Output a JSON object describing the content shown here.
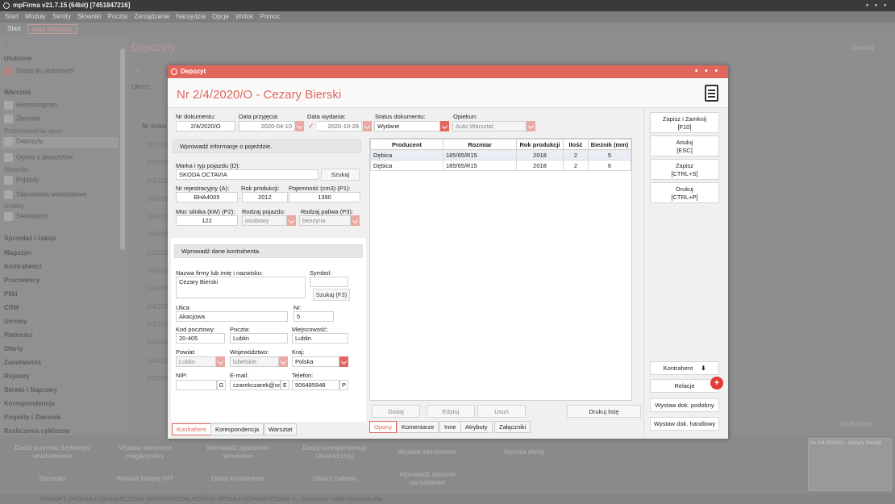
{
  "app": {
    "title": "mpFirma v21.7.15 (64bit) [7451847216]",
    "title_dots": "• • •"
  },
  "menu": [
    "Start",
    "Moduły",
    "Skróty",
    "Słowniki",
    "Poczta",
    "Zarządzanie",
    "Narzędzia",
    "Opcje",
    "Widok",
    "Pomoc"
  ],
  "tabs": [
    "Start",
    "Auto Warsztat"
  ],
  "sidebar": {
    "search_icon": "search-icon",
    "favorites": "Ulubione",
    "add_fav": "Dodaj do ulubionych",
    "workshop": "Warsztat",
    "items": [
      "Harmonogram",
      "Zlecenia"
    ],
    "tyre_storage": "Przechowalnia opon",
    "tyre_items": [
      "Depozyty",
      "Opony z depozytów"
    ],
    "dicts": "Słowniki",
    "dict_items": [
      "Pojazdy",
      "Stanowiska warsztatowe"
    ],
    "analytics": "Analizy",
    "analytics_items": [
      "Serwisanci"
    ],
    "sections": [
      "Sprzedaż i zakup",
      "Magazyn",
      "Kontrahenci",
      "Pracownicy",
      "Pliki",
      "CRM",
      "Umowy",
      "Płatności",
      "Oferty",
      "Zamówienia",
      "Rejestry",
      "Serwis i Naprawy",
      "Korespondencja",
      "Projekty i Zlecenia",
      "Rozliczenia cykliczne",
      "Raporty zbiorcze"
    ]
  },
  "background": {
    "page_title": "Depozyty",
    "close": "Zamknij",
    "period": "Okres:",
    "col": "Nr doku",
    "dates": [
      "2/7/202",
      "1/7/202",
      "4/4/202",
      "3/4/202",
      "2/4/202",
      "1/4/202",
      "1/11/20",
      "1/10/20",
      "1/5/202",
      "4/4/202",
      "3/4/202",
      "2/4/202",
      "1/4/202",
      "1/3/202"
    ],
    "print_list": "Drukuj listę",
    "right_title": "Nr 2/4/2020/O - Cezary Bierski"
  },
  "bottom_buttons": [
    [
      "Dodaj przyciski Szybkiego uruchamiania",
      "Wystaw dokument magazynowy",
      "Wprowadź zgłoszenie serwisowe",
      "Dodaj korespondencję (zewnętrzną)",
      "Wystaw zamówienie",
      "Wystaw ofertę"
    ],
    [
      "Sprzedaż",
      "Wystaw fakturę VAT",
      "Dodaj kontrahenta",
      "Utwórz zadanie",
      "Wprowadź zlecenie warsztatowe"
    ]
  ],
  "status_text": "BINSOFT SPÓŁKA Z OGRANICZONĄ ODPOWIEDZIALNOŚCIĄ SPÓŁKA KOMANDYTOWA n... Database: sqlite:Warsztat.dbx",
  "dialog": {
    "title": "Depozyt",
    "dots": "• • •",
    "heading": "Nr 2/4/2020/O - Cezary Bierski",
    "doc_no_label": "Nr dokumentu:",
    "doc_no": "2/4/2020/O",
    "date_in_label": "Data przyjęcia:",
    "date_in": "2020-04-10",
    "date_out_label": "Data wydania:",
    "date_out": "2020-10-28",
    "status_label": "Status dokumentu:",
    "status": "Wydane",
    "keeper_label": "Opiekun:",
    "keeper": "Auto Warsztat",
    "vehicle_section": "Wprowadź informacje o pojeździe.",
    "make_label": "Marka i typ pojazdu (D):",
    "make": "SKODA OCTAVIA",
    "search": "Szukaj",
    "reg_label": "Nr rejestracyjny (A):",
    "reg": "BHA4005",
    "year_label": "Rok produkcji:",
    "year": "2012",
    "capacity_label": "Pojemność (cm3) (P1):",
    "capacity": "1390",
    "power_label": "Moc silnika (kW) (P2):",
    "power": "122",
    "vtype_label": "Rodzaj pojazdu:",
    "vtype": "osobowy",
    "fuel_label": "Rodzaj paliwa (P3):",
    "fuel": "benzyna",
    "contractor_section": "Wprowadź dane kontrahenta.",
    "name_label": "Nazwa firmy lub imię i nazwisko:",
    "name": "Cezary Bierski",
    "symbol_label": "Symbol:",
    "symbol": "",
    "search_f3": "Szukaj (F3)",
    "street_label": "Ulica:",
    "street": "Akacjowa",
    "no_label": "Nr:",
    "no": "5",
    "zip_label": "Kod pocztowy:",
    "zip": "20-405",
    "post_label": "Poczta:",
    "post": "Lublin",
    "city_label": "Miejscowość:",
    "city": "Lublin",
    "county_label": "Powiat:",
    "county": "Lublin",
    "voiv_label": "Województwo:",
    "voiv": "lubelskie",
    "country_label": "Kraj:",
    "country": "Polska",
    "nip_label": "NIP:",
    "nip": "",
    "nip_suffix": "G",
    "email_label": "E-mail:",
    "email": "czarekczarek@on",
    "email_suffix": "E",
    "phone_label": "Telefon:",
    "phone": "506485948",
    "phone_suffix": "P",
    "left_tabs": [
      "Kontrahent",
      "Korespondencja",
      "Warsztat"
    ],
    "grid_headers": [
      "Producent",
      "Rozmiar",
      "Rok produkcji",
      "Ilość",
      "Bieżnik (mm)"
    ],
    "grid_rows": [
      [
        "Dębica",
        "185/65/R15",
        "2018",
        "2",
        "5"
      ],
      [
        "Dębica",
        "185/65/R15",
        "2018",
        "2",
        "6"
      ]
    ],
    "grid_buttons": {
      "add": "Dodaj",
      "edit": "Edytuj",
      "delete": "Usuń",
      "print_list": "Drukuj listę"
    },
    "bottom_tabs": [
      "Opony",
      "Komentarze",
      "Inne",
      "Atrybuty",
      "Załączniki"
    ],
    "right_buttons": {
      "save_close": "Zapisz i Zamknij",
      "save_close_key": "[F10]",
      "cancel": "Anuluj",
      "cancel_key": "[ESC]",
      "save": "Zapisz",
      "save_key": "[CTRL+S]",
      "print": "Drukuj",
      "print_key": "[CTRL+P]",
      "contractor": "Kontrahent",
      "relations": "Relacje",
      "relations_badge": "+",
      "similar": "Wystaw dok. podobny",
      "commercial": "Wystaw dok. handlowy"
    }
  }
}
